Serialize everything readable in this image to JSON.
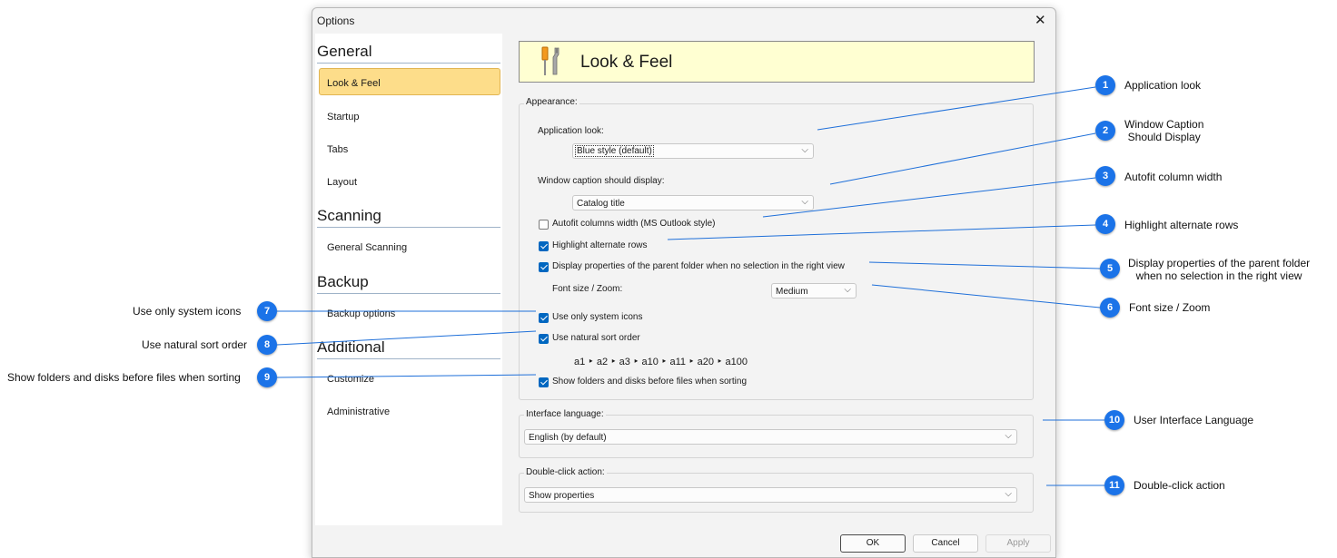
{
  "dialog": {
    "title": "Options",
    "close_glyph": "✕",
    "buttons": {
      "ok": "OK",
      "cancel": "Cancel",
      "apply": "Apply"
    }
  },
  "sidebar": {
    "sections": [
      {
        "heading": "General",
        "items": [
          "Look & Feel",
          "Startup",
          "Tabs",
          "Layout"
        ]
      },
      {
        "heading": "Scanning",
        "items": [
          "General Scanning"
        ]
      },
      {
        "heading": "Backup",
        "items": [
          "Backup options"
        ]
      },
      {
        "heading": "Additional",
        "items": [
          "Customize",
          "Administrative"
        ]
      }
    ],
    "selected": "Look & Feel"
  },
  "page": {
    "title": "Look & Feel",
    "icon": "tools-icon",
    "appearance": {
      "group_label": "Appearance:",
      "app_look_label": "Application look:",
      "app_look_value": "Blue style (default)",
      "caption_label": "Window caption should display:",
      "caption_value": "Catalog title",
      "autofit_label": "Autofit columns width (MS Outlook style)",
      "autofit_checked": false,
      "highlight_label": "Highlight alternate rows",
      "highlight_checked": true,
      "parent_props_label": "Display properties of the parent folder when no selection in the right view",
      "parent_props_checked": true,
      "font_label": "Font size / Zoom:",
      "font_value": "Medium",
      "system_icons_label": "Use only system icons",
      "system_icons_checked": true,
      "natural_sort_label": "Use natural sort order",
      "natural_sort_checked": true,
      "natural_sort_example": "a1 ‣ a2 ‣ a3 ‣ a10 ‣ a11 ‣ a20 ‣ a100",
      "folders_first_label": "Show folders and disks before files when sorting",
      "folders_first_checked": true
    },
    "language": {
      "group_label": "Interface language:",
      "value": "English (by default)"
    },
    "double_click": {
      "group_label": "Double-click action:",
      "value": "Show properties"
    }
  },
  "callouts": [
    {
      "n": "1",
      "text": "Application look"
    },
    {
      "n": "2",
      "text": "Window Caption\nShould Display"
    },
    {
      "n": "3",
      "text": "Autofit column width"
    },
    {
      "n": "4",
      "text": "Highlight alternate rows"
    },
    {
      "n": "5",
      "text": "Display properties of the parent folder\nwhen no selection in the right view"
    },
    {
      "n": "6",
      "text": "Font size / Zoom"
    },
    {
      "n": "7",
      "text": "Use only system icons"
    },
    {
      "n": "8",
      "text": "Use natural sort order"
    },
    {
      "n": "9",
      "text": "Show folders and disks before files when sorting"
    },
    {
      "n": "10",
      "text": "User Interface Language"
    },
    {
      "n": "11",
      "text": "Double-click action"
    }
  ],
  "colors": {
    "accent": "#0067c0",
    "selection": "#fddd8a",
    "banner": "#ffffd2",
    "callout": "#1b73e8"
  }
}
